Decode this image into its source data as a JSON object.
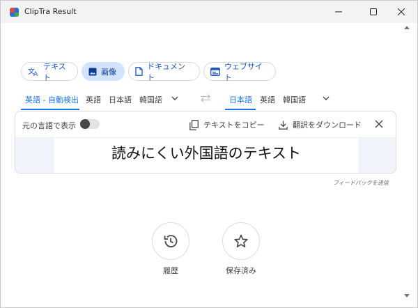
{
  "window": {
    "title": "ClipTra Result"
  },
  "modes": [
    {
      "label": "テキスト",
      "icon": "translate-icon",
      "active": false
    },
    {
      "label": "画像",
      "icon": "image-icon",
      "active": true
    },
    {
      "label": "ドキュメント",
      "icon": "document-icon",
      "active": false
    },
    {
      "label": "ウェブサイト",
      "icon": "website-icon",
      "active": false
    }
  ],
  "source_languages": [
    "英語 - 自動検出",
    "英語",
    "日本語",
    "韓国語"
  ],
  "target_languages": [
    "日本語",
    "英語",
    "韓国語"
  ],
  "card": {
    "show_original_label": "元の言語で表示",
    "show_original_on": false,
    "copy_label": "テキストをコピー",
    "download_label": "翻訳をダウンロード",
    "result_text": "読みにくい外国語のテキスト"
  },
  "feedback_label": "フィードバックを送信",
  "history_label": "履歴",
  "saved_label": "保存済み",
  "colors": {
    "accent": "#1a73e8",
    "active_chip": "#d3e3fd"
  }
}
